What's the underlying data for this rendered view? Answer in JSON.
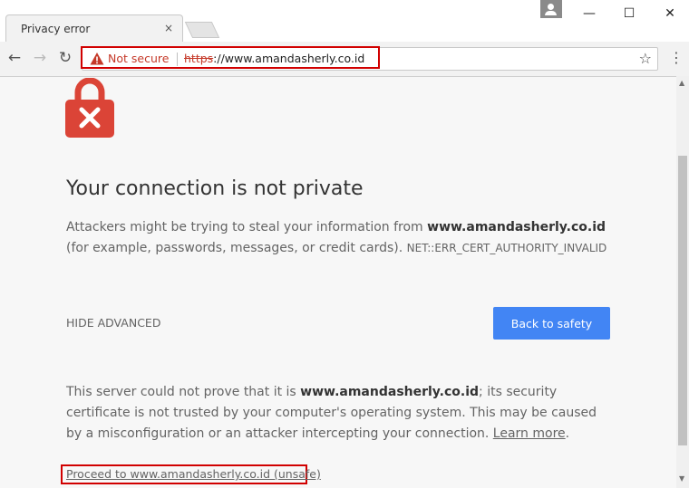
{
  "tab": {
    "title": "Privacy error",
    "close_icon": "×"
  },
  "window": {
    "minimize": "—",
    "maximize": "☐",
    "close": "✕"
  },
  "toolbar": {
    "back": "←",
    "forward": "→",
    "reload": "↻",
    "star": "☆",
    "menu": "⋮"
  },
  "address_bar": {
    "security_label": "Not secure",
    "scheme": "https",
    "url_rest": "://www.amandasherly.co.id"
  },
  "page": {
    "heading": "Your connection is not private",
    "p1_pre": "Attackers might be trying to steal your information from ",
    "p1_domain": "www.amandasherly.co.id",
    "p1_post": " (for example, passwords, messages, or credit cards). ",
    "error_code": "NET::ERR_CERT_AUTHORITY_INVALID",
    "hide_advanced": "HIDE ADVANCED",
    "back_button": "Back to safety",
    "p2_pre": "This server could not prove that it is ",
    "p2_domain": "www.amandasherly.co.id",
    "p2_post": "; its security certificate is not trusted by your computer's operating system. This may be caused by a misconfiguration or an attacker intercepting your connection. ",
    "learn_more": "Learn more",
    "p2_end": ".",
    "proceed_link": "Proceed to www.amandasherly.co.id (unsafe)"
  },
  "colors": {
    "accent_button": "#4285f4",
    "danger": "#db4437",
    "not_secure": "#c53929"
  }
}
